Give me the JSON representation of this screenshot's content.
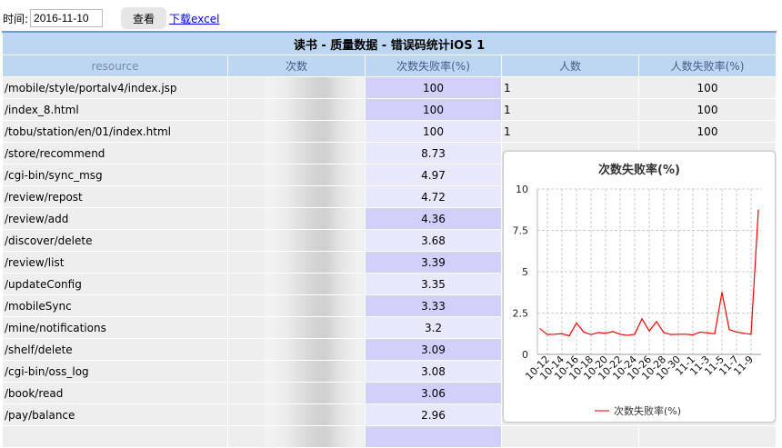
{
  "toolbar": {
    "date_label": "时间:",
    "date_value": "2016-11-10",
    "view_button": "查看",
    "download_link": "下载excel"
  },
  "table": {
    "title": "读书 - 质量数据 - 错误码统计iOS 1",
    "headers": [
      "resource",
      "次数",
      "次数失败率(%)",
      "人数",
      "人数失败率(%)"
    ],
    "rows": [
      {
        "resource": "/mobile/style/portalv4/index.jsp",
        "rate": "100",
        "dark": true,
        "people": "1",
        "people_rate": "100"
      },
      {
        "resource": "/index_8.html",
        "rate": "100",
        "dark": true,
        "people": "1",
        "people_rate": "100"
      },
      {
        "resource": "/tobu/station/en/01/index.html",
        "rate": "100",
        "dark": false,
        "people": "1",
        "people_rate": "100"
      },
      {
        "resource": "/store/recommend",
        "rate": "8.73",
        "dark": false
      },
      {
        "resource": "/cgi-bin/sync_msg",
        "rate": "4.97",
        "dark": false
      },
      {
        "resource": "/review/repost",
        "rate": "4.72",
        "dark": false
      },
      {
        "resource": "/review/add",
        "rate": "4.36",
        "dark": true
      },
      {
        "resource": "/discover/delete",
        "rate": "3.68",
        "dark": false
      },
      {
        "resource": "/review/list",
        "rate": "3.39",
        "dark": true
      },
      {
        "resource": "/updateConfig",
        "rate": "3.35",
        "dark": false
      },
      {
        "resource": "/mobileSync",
        "rate": "3.33",
        "dark": true
      },
      {
        "resource": "/mine/notifications",
        "rate": "3.2",
        "dark": false
      },
      {
        "resource": "/shelf/delete",
        "rate": "3.09",
        "dark": true
      },
      {
        "resource": "/cgi-bin/oss_log",
        "rate": "3.08",
        "dark": false
      },
      {
        "resource": "/book/read",
        "rate": "3.06",
        "dark": true
      },
      {
        "resource": "/pay/balance",
        "rate": "2.96",
        "dark": false
      },
      {
        "resource": "",
        "rate": "",
        "dark": true
      }
    ]
  },
  "chart_data": {
    "type": "line",
    "title": "次数失败率(%)",
    "legend": "次数失败率(%)",
    "legend_position": "bottom",
    "color": "#ff0000",
    "ylim": [
      0,
      10
    ],
    "yticks": [
      "0",
      "2.5",
      "5",
      "7.5",
      "10"
    ],
    "x": [
      "10-11",
      "10-12",
      "10-13",
      "10-14",
      "10-15",
      "10-16",
      "10-17",
      "10-18",
      "10-19",
      "10-20",
      "10-21",
      "10-22",
      "10-23",
      "10-24",
      "10-25",
      "10-26",
      "10-27",
      "10-28",
      "10-29",
      "10-30",
      "10-31",
      "11-1",
      "11-2",
      "11-3",
      "11-4",
      "11-5",
      "11-6",
      "11-7",
      "11-8",
      "11-9",
      "11-10"
    ],
    "xticks": [
      "10-12",
      "10-14",
      "10-16",
      "10-18",
      "10-20",
      "10-22",
      "10-24",
      "10-26",
      "10-28",
      "10-30",
      "11-1",
      "11-3",
      "11-5",
      "11-7",
      "11-9"
    ],
    "values": [
      1.55,
      1.2,
      1.22,
      1.25,
      1.12,
      1.9,
      1.35,
      1.2,
      1.32,
      1.28,
      1.38,
      1.22,
      1.15,
      1.22,
      2.15,
      1.42,
      1.98,
      1.32,
      1.2,
      1.22,
      1.22,
      1.18,
      1.35,
      1.3,
      1.25,
      3.75,
      1.5,
      1.35,
      1.28,
      1.22,
      8.73
    ],
    "grid": true
  }
}
